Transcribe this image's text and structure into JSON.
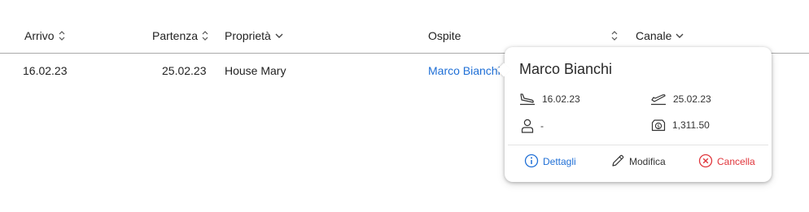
{
  "table": {
    "headers": {
      "arrivo": "Arrivo",
      "partenza": "Partenza",
      "proprieta": "Proprietà",
      "ospite": "Ospite",
      "canale": "Canale"
    },
    "row": {
      "arrivo": "16.02.23",
      "partenza": "25.02.23",
      "proprieta": "House Mary",
      "ospite": "Marco Bianchi"
    }
  },
  "popover": {
    "title": "Marco Bianchi",
    "check_in": "16.02.23",
    "check_out": "25.02.23",
    "guests": "-",
    "amount": "1,311.50",
    "actions": {
      "details": "Dettagli",
      "edit": "Modifica",
      "cancel": "Cancella"
    }
  },
  "colors": {
    "link": "#1f6fd6",
    "danger": "#e0353b",
    "header_divider": "#a9a9a9"
  },
  "icons": {
    "sort": "sort-updown-icon",
    "dropdown": "chevron-down-icon",
    "check_in": "plane-landing-icon",
    "check_out": "plane-takeoff-icon",
    "guests": "person-icon",
    "amount": "money-icon",
    "details": "info-circle-icon",
    "edit": "pencil-icon",
    "cancel": "x-circle-icon"
  }
}
